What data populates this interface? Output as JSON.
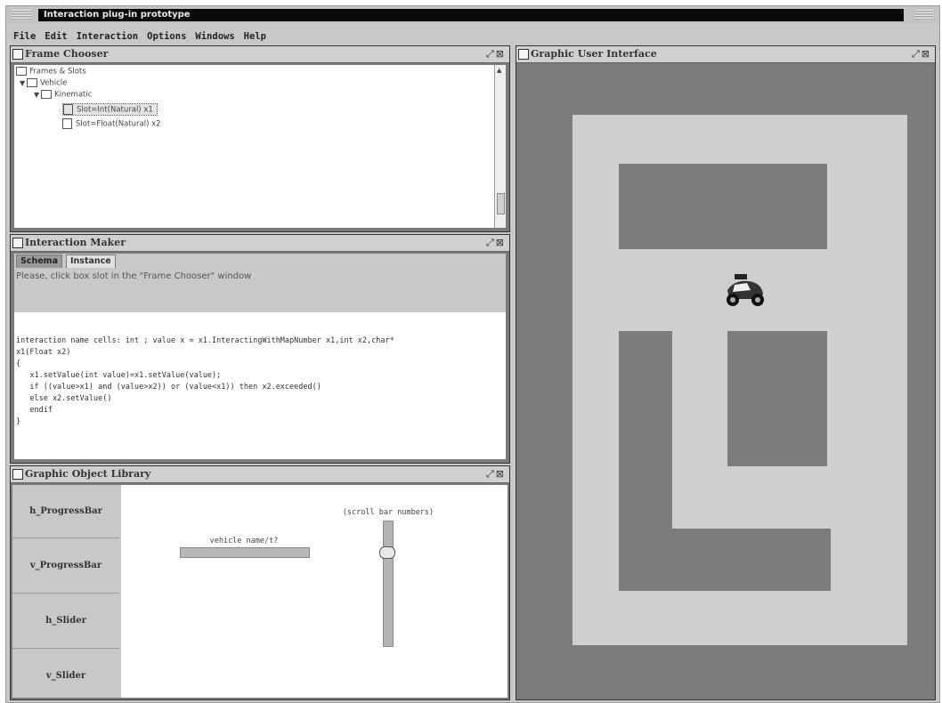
{
  "app": {
    "title": "Interaction plug-in prototype"
  },
  "menu": [
    "File",
    "Edit",
    "Interaction",
    "Options",
    "Windows",
    "Help"
  ],
  "frame_chooser": {
    "title": "Frame Chooser",
    "tree": {
      "root": "Frames & Slots",
      "level1": "Vehicle",
      "level2": "Kinematic",
      "items": [
        "Slot=Int(Natural) x1",
        "Slot=Float(Natural) x2"
      ]
    }
  },
  "interaction_maker": {
    "title": "Interaction Maker",
    "tabs": [
      "Schema",
      "Instance"
    ],
    "hint": "Please, click box slot in the \"Frame Chooser\" window",
    "code": [
      "interaction name cells: int ; value x = x1.InteractingWithMapNumber x1,int x2,char*",
      "x1(Float x2)",
      "{",
      "   x1.setValue(int value)=x1.setValue(value);",
      "   if ((value>x1) and (value>x2)) or (value<x1)) then x2.exceeded()",
      "   else x2.setValue()",
      "   endif",
      "}"
    ]
  },
  "library": {
    "title": "Graphic Object Library",
    "items": [
      "h_ProgressBar",
      "v_ProgressBar",
      "h_Slider",
      "v_Slider"
    ],
    "preview_h_label": "vehicle name/t?",
    "preview_v_label": "(scroll bar numbers)",
    "slider_level": 0.25
  },
  "gui": {
    "title": "Graphic User Interface"
  },
  "colors": {
    "panel": "#c8c8c8",
    "dark_panel": "#7c7c7c",
    "road": "#d0d0d0",
    "block": "#7c7c7c"
  },
  "icons": {
    "close": "close-icon",
    "resize": "resize-icon",
    "vehicle": "vehicle-icon"
  }
}
